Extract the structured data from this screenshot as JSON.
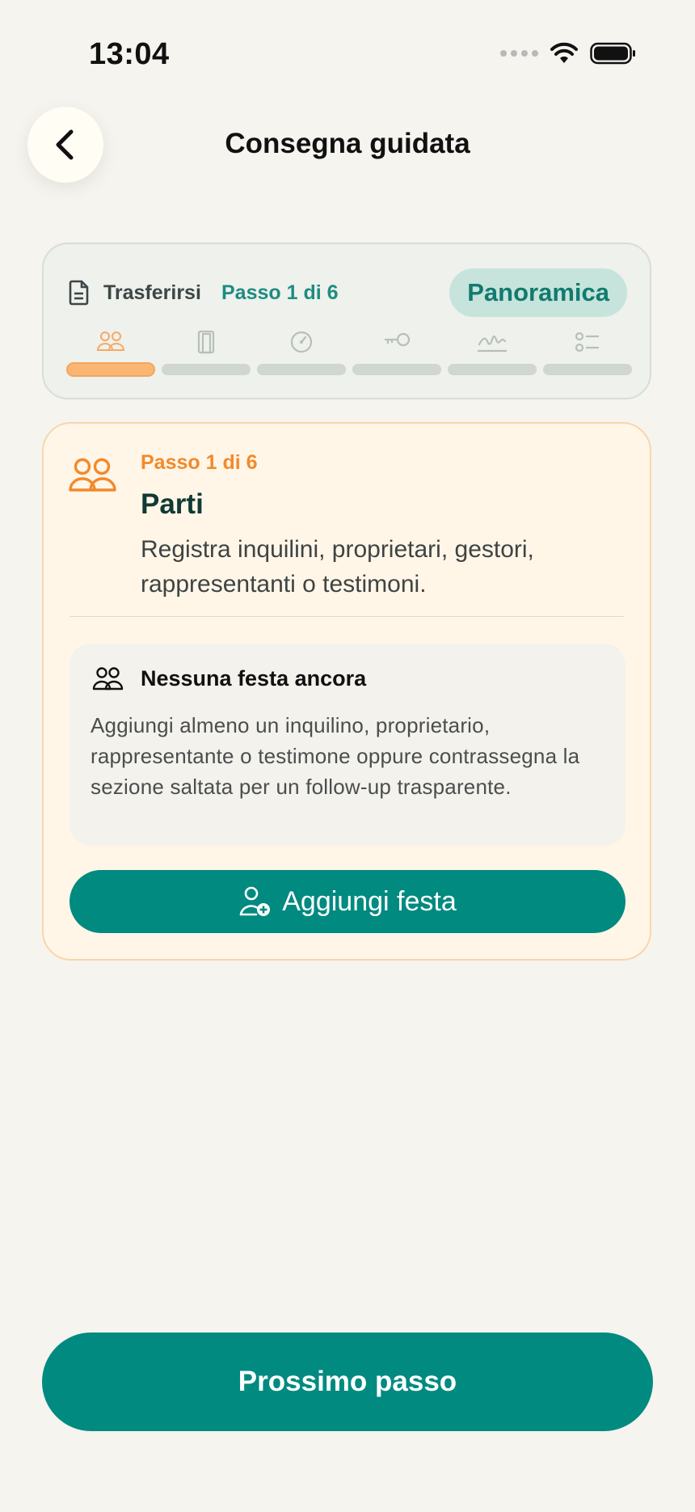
{
  "status": {
    "time": "13:04"
  },
  "header": {
    "title": "Consegna guidata"
  },
  "progress": {
    "label": "Trasferirsi",
    "step_text": "Passo 1 di 6",
    "overview_label": "Panoramica",
    "current_step": 1,
    "total_steps": 6,
    "steps": [
      {
        "icon": "people-icon"
      },
      {
        "icon": "door-icon"
      },
      {
        "icon": "meter-icon"
      },
      {
        "icon": "key-icon"
      },
      {
        "icon": "signature-icon"
      },
      {
        "icon": "checklist-icon"
      }
    ]
  },
  "step_card": {
    "kicker": "Passo 1 di 6",
    "title": "Parti",
    "description": "Registra inquilini, proprietari, gestori, rappresentanti o testimoni.",
    "empty_title": "Nessuna festa ancora",
    "empty_text": "Aggiungi almeno un inquilino, proprietario, rappresentante o testimone oppure contrassegna la sezione saltata per un follow-up trasparente.",
    "add_label": "Aggiungi festa"
  },
  "footer": {
    "next_label": "Prossimo passo"
  },
  "colors": {
    "accent": "#008A80",
    "orange": "#F28A2B",
    "background": "#F5F4EF"
  }
}
